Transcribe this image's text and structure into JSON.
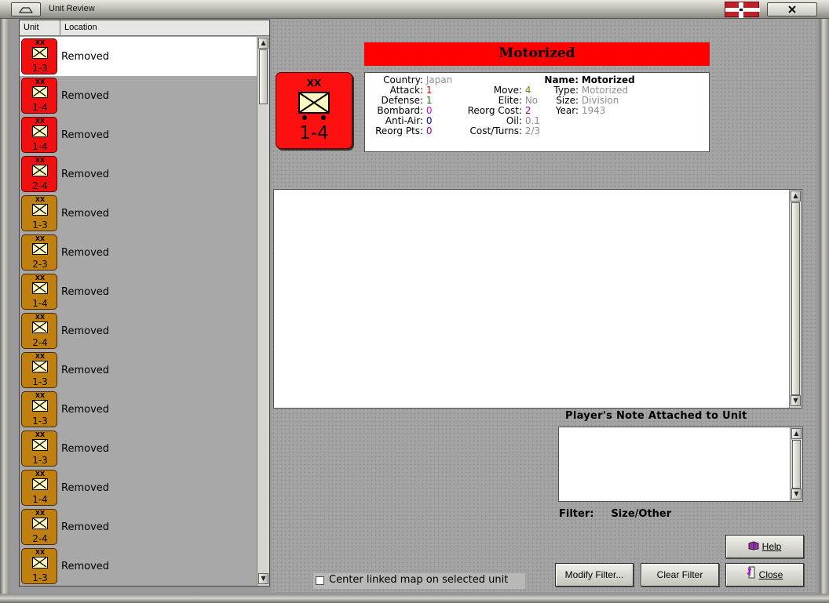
{
  "window": {
    "title": "Unit Review"
  },
  "list": {
    "headers": {
      "unit": "Unit",
      "location": "Location"
    },
    "rows": [
      {
        "strength": "1-3",
        "location": "Removed",
        "color": "red",
        "selected": true
      },
      {
        "strength": "1-4",
        "location": "Removed",
        "color": "red",
        "selected": false
      },
      {
        "strength": "1-4",
        "location": "Removed",
        "color": "red",
        "selected": false
      },
      {
        "strength": "2-4",
        "location": "Removed",
        "color": "red",
        "selected": false
      },
      {
        "strength": "1-3",
        "location": "Removed",
        "color": "amber",
        "selected": false
      },
      {
        "strength": "2-3",
        "location": "Removed",
        "color": "amber",
        "selected": false
      },
      {
        "strength": "1-4",
        "location": "Removed",
        "color": "amber",
        "selected": false
      },
      {
        "strength": "2-4",
        "location": "Removed",
        "color": "amber",
        "selected": false
      },
      {
        "strength": "1-3",
        "location": "Removed",
        "color": "amber",
        "selected": false
      },
      {
        "strength": "1-3",
        "location": "Removed",
        "color": "amber",
        "selected": false
      },
      {
        "strength": "1-3",
        "location": "Removed",
        "color": "amber",
        "selected": false
      },
      {
        "strength": "1-4",
        "location": "Removed",
        "color": "amber",
        "selected": false
      },
      {
        "strength": "2-4",
        "location": "Removed",
        "color": "amber",
        "selected": false
      },
      {
        "strength": "1-3",
        "location": "Removed",
        "color": "amber",
        "selected": false
      }
    ],
    "size_symbol": "XX"
  },
  "unit": {
    "banner": "Motorized",
    "counter": {
      "size_symbol": "XX",
      "strength": "1-4"
    },
    "stats": {
      "country": {
        "label": "Country:",
        "value": "Japan"
      },
      "attack": {
        "label": "Attack:",
        "value": "1"
      },
      "defense": {
        "label": "Defense:",
        "value": "1"
      },
      "bombard": {
        "label": "Bombard:",
        "value": "0"
      },
      "anti_air": {
        "label": "Anti-Air:",
        "value": "0"
      },
      "reorg_pts": {
        "label": "Reorg Pts:",
        "value": "0"
      },
      "move": {
        "label": "Move:",
        "value": "4"
      },
      "elite": {
        "label": "Elite:",
        "value": "No"
      },
      "reorg_cost": {
        "label": "Reorg Cost:",
        "value": "2"
      },
      "oil": {
        "label": "Oil:",
        "value": "0.1"
      },
      "cost_turns": {
        "label": "Cost/Turns:",
        "value": "2/3"
      },
      "name": {
        "label": "Name:",
        "value": "Motorized"
      },
      "type": {
        "label": "Type:",
        "value": "Motorized"
      },
      "size": {
        "label": "Size:",
        "value": "Division"
      },
      "year": {
        "label": "Year:",
        "value": "1943"
      }
    }
  },
  "note": {
    "title": "Player's Note Attached to Unit"
  },
  "filter": {
    "label": "Filter:",
    "value": "Size/Other"
  },
  "options": {
    "center_map_label": "Center linked map on selected unit",
    "center_map_checked": false
  },
  "buttons": {
    "help": "Help",
    "modify_filter": "Modify Filter...",
    "clear_filter": "Clear Filter",
    "close": "Close"
  },
  "colors": {
    "red_counter": "#f01010",
    "amber_counter": "#c08010",
    "banner": "#ff0000"
  }
}
